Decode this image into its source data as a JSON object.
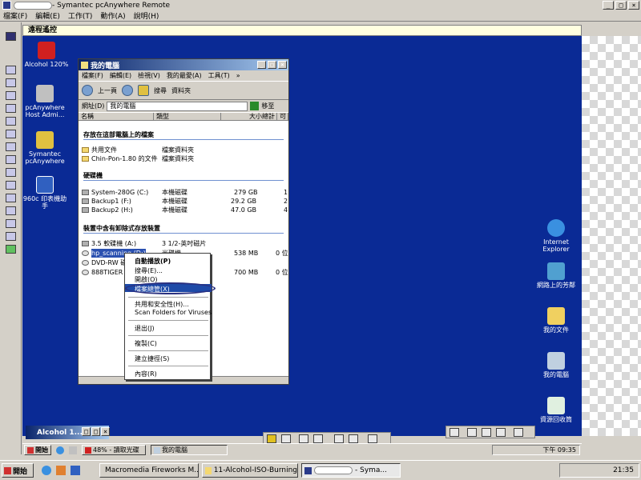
{
  "outer": {
    "title_suffix": " - Symantec pcAnywhere Remote",
    "menu": [
      "檔案(F)",
      "編輯(E)",
      "工作(T)",
      "動作(A)",
      "說明(H)"
    ]
  },
  "remote_header": "遠程遙控",
  "desktop_icons": {
    "left": [
      {
        "label": "Alcohol 120%"
      },
      {
        "label": "pcAnywhere Host Admi..."
      },
      {
        "label": "Symantec pcAnywhere"
      },
      {
        "label": "960c 印表機助手"
      }
    ],
    "right": [
      {
        "label": "Internet Explorer"
      },
      {
        "label": "網路上的芳鄰"
      },
      {
        "label": "我的文件"
      },
      {
        "label": "我的電腦"
      },
      {
        "label": "資源回收筒"
      }
    ]
  },
  "mycomputer": {
    "title": "我的電腦",
    "menu": [
      "檔案(F)",
      "編輯(E)",
      "檢視(V)",
      "我的最愛(A)",
      "工具(T)",
      "»"
    ],
    "toolbar": {
      "back": "上一頁",
      "search": "搜尋",
      "folders": "資料夾"
    },
    "address_label": "網址(D)",
    "address_value": "我的電腦",
    "go_label": "移至",
    "columns": [
      "名稱",
      "類型",
      "大小總計",
      "可"
    ],
    "groups": {
      "files": "存放在這部電腦上的檔案",
      "hdd": "硬碟機",
      "removable": "裝置中含有卸除式存放裝置"
    },
    "files": [
      {
        "name": "共用文件",
        "type": "檔案資料夾"
      },
      {
        "name": "Chin-Pon-1.80 的文件",
        "type": "檔案資料夾"
      }
    ],
    "drives": [
      {
        "name": "System-280G (C:)",
        "type": "本機磁碟",
        "size": "279 GB",
        "free": "1"
      },
      {
        "name": "Backup1 (F:)",
        "type": "本機磁碟",
        "size": "29.2 GB",
        "free": "2"
      },
      {
        "name": "Backup2 (H:)",
        "type": "本機磁碟",
        "size": "47.0 GB",
        "free": "4"
      }
    ],
    "removable": [
      {
        "name": "3.5 軟碟機 (A:)",
        "type": "3 1/2-英吋磁片",
        "size": "",
        "free": ""
      },
      {
        "name": "hp_scanning (D:)",
        "type": "光碟機",
        "size": "538 MB",
        "free": "0 位"
      },
      {
        "name": "DVD-RW 磁",
        "type": "",
        "size": "",
        "free": ""
      },
      {
        "name": "888TIGER",
        "type": "",
        "size": "700 MB",
        "free": "0 位"
      }
    ]
  },
  "context_menu": [
    {
      "label": "自動播放(P)",
      "bold": true
    },
    {
      "label": "搜尋(E)..."
    },
    {
      "label": "開啟(O)"
    },
    {
      "label": "檔案總管(X)",
      "highlight": true
    },
    {
      "sep": true
    },
    {
      "label": "共用和安全性(H)..."
    },
    {
      "label": "Scan Folders for Viruses"
    },
    {
      "sep": true
    },
    {
      "label": "退出(J)"
    },
    {
      "sep": true
    },
    {
      "label": "複製(C)"
    },
    {
      "sep": true
    },
    {
      "label": "建立捷徑(S)"
    },
    {
      "sep": true
    },
    {
      "label": "內容(R)"
    }
  ],
  "alcohol_window": "Alcohol 1...",
  "remote_taskbar": {
    "start": "開始",
    "items": [
      "48% - 讀取光碟",
      "我的電腦"
    ],
    "clock": "下午 09:35"
  },
  "taskbar": {
    "start": "開始",
    "items": [
      "Macromedia Fireworks M...",
      "11-Alcohol-ISO-Burning",
      " - Syma..."
    ],
    "clock": "21:35"
  },
  "colors": {
    "desktop": "#0a2a95",
    "titlebar": "#0a246a",
    "highlight": "#1e4aa8"
  }
}
